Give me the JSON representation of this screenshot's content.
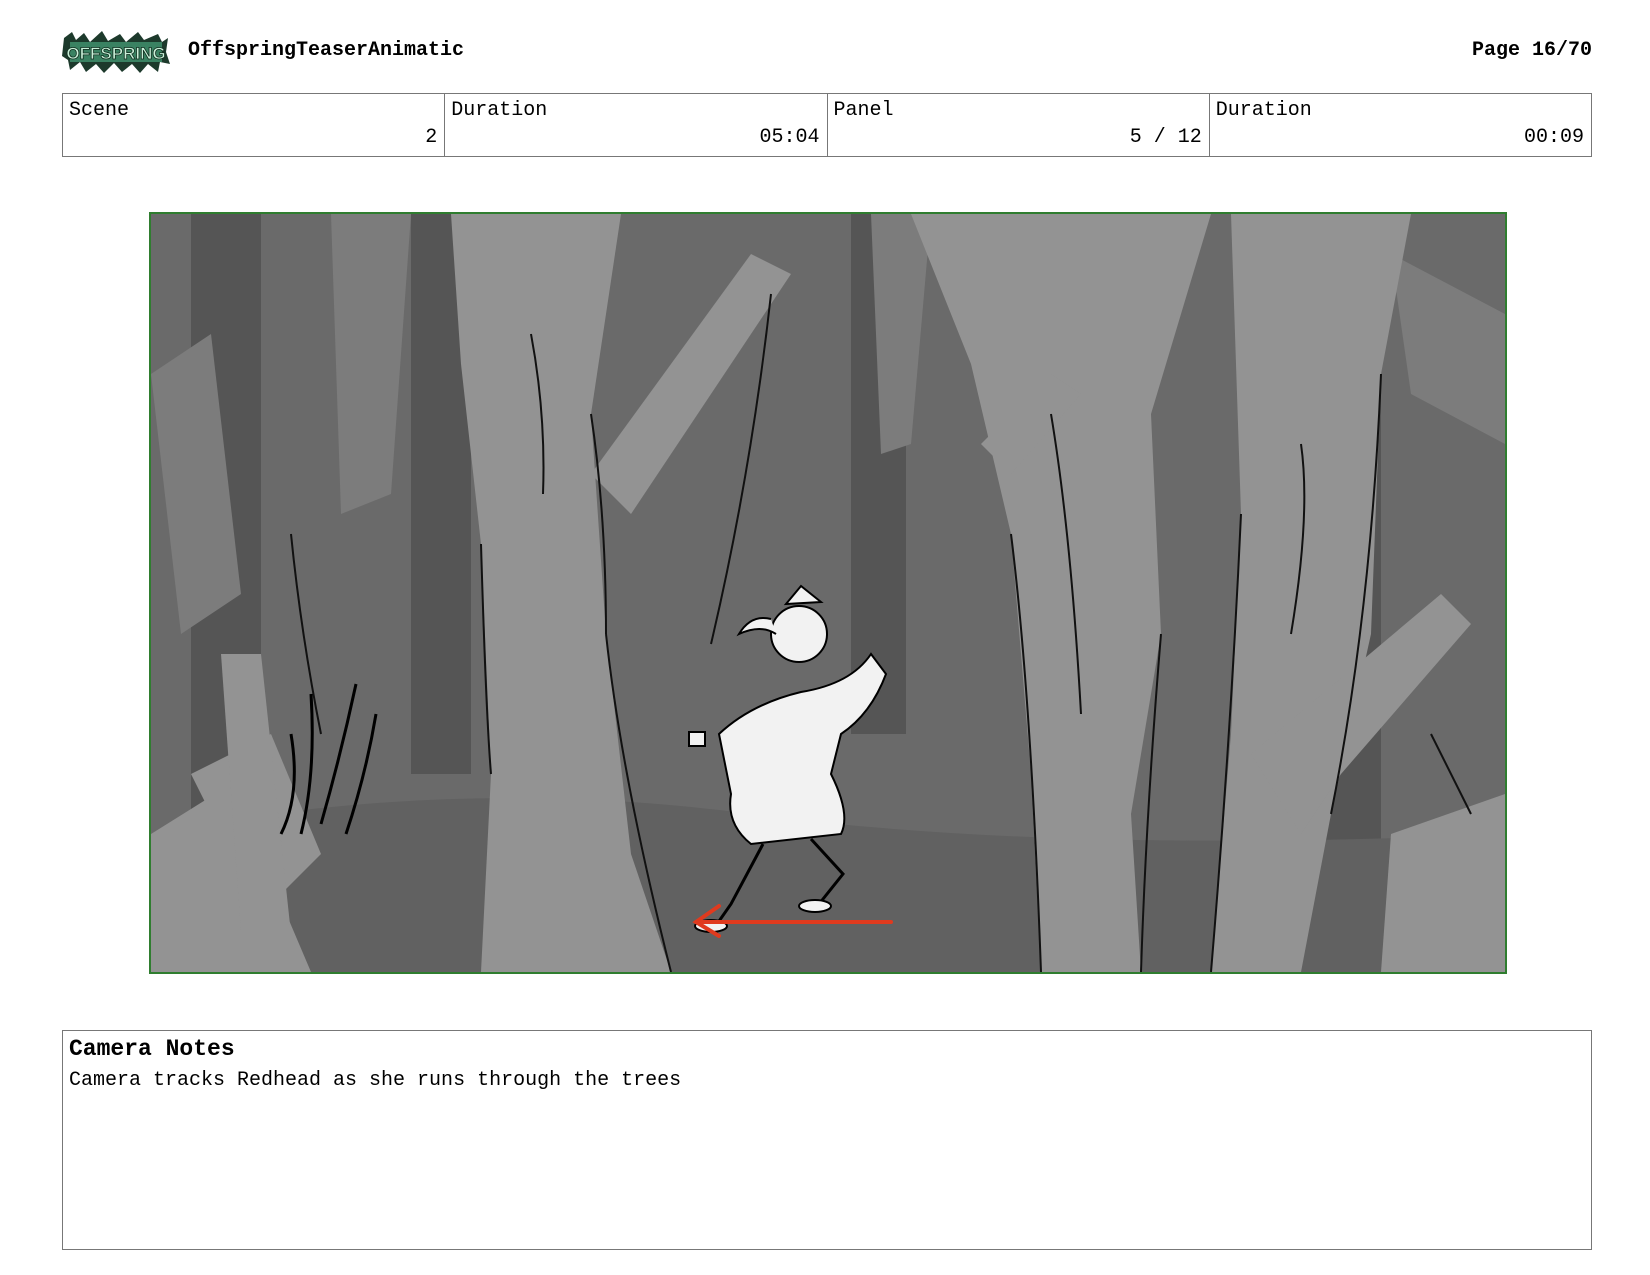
{
  "header": {
    "logo_text": "OFFSPRING",
    "project_title": "OffspringTeaserAnimatic",
    "page": "Page 16/70"
  },
  "info": {
    "scene_label": "Scene",
    "scene_value": "2",
    "scene_duration_label": "Duration",
    "scene_duration_value": "05:04",
    "panel_label": "Panel",
    "panel_value": "5 / 12",
    "panel_duration_label": "Duration",
    "panel_duration_value": "00:09"
  },
  "panel_image": {
    "icon": "storyboard-sketch",
    "arrow_color": "#e03a1e"
  },
  "notes": {
    "title": "Camera Notes",
    "text": "Camera tracks Redhead as she runs through the trees"
  }
}
